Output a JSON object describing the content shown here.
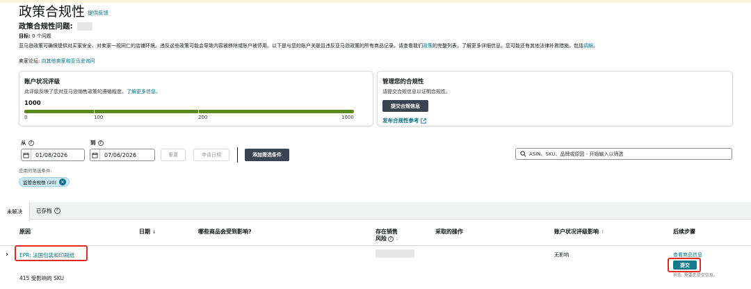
{
  "header": {
    "title": "政策合规性",
    "feedback": "提供反馈",
    "issue_label": "政策合规性问题:",
    "goal_label": "目标:",
    "goal_value": "0 个问题",
    "policy_text_prefix": "亚马逊政策可确保提供对买家安全、对卖家一视同仁的店铺环境。违反这些政策可能会导致内容被移除或账户被停用。以下是与您的账户关联且违反亚马逊政策的所有商品记录。请查看我们",
    "policy_link": "政策",
    "policy_text_mid": "的完整列表，了解更多详细信息。您可能还有其他法律补救措施，包括",
    "remedy_link": "调解",
    "policy_text_end": "。",
    "forum_label": "卖家论坛:",
    "forum_link": "向其他卖家和亚马逊询问"
  },
  "rating_card": {
    "title": "账户状况评级",
    "desc": "此评级反映了您对亚马逊销售政策的遵循程度。",
    "desc_link": "了解更多信息。",
    "score": "1000",
    "progress": 1.0,
    "ticks": [
      "0",
      "100",
      "200",
      "1000"
    ]
  },
  "manage_card": {
    "title": "管理您的合规性",
    "desc": "请提交合规信息以证明合规性。",
    "submit_button": "提交合规信息",
    "reference_link": "发布合规性参考"
  },
  "filters": {
    "from_label": "从",
    "to_label": "到",
    "from_date": "01/08/2026",
    "to_date": "07/06/2026",
    "reset": "重置",
    "apply_date": "申请日期",
    "add_filter": "添加筛选条件",
    "search_placeholder": "ASIN、SKU、品牌或原因 - 开始输入以筛选",
    "applied_label": "应用的筛选条件:",
    "chip_label": "监管合规性 (20)"
  },
  "tabs": {
    "unresolved": "未解决",
    "archived": "已存档"
  },
  "table": {
    "headers": {
      "reason": "原因",
      "date": "日期",
      "affected": "哪些商品会受到影响?",
      "risk_line1": "存在销售",
      "risk_line2": "风险",
      "action": "采取的操作",
      "rating_impact": "账户状况评级影响",
      "next_steps": "后续步骤"
    },
    "rows": [
      {
        "reason": "EPR: 法国包装和印刷纸",
        "sku_count": "415 受影响的 SKU",
        "impact": "无影响",
        "view_link": "查看商品信息",
        "submit": "提交",
        "status": "状态: 需要您提交信息。"
      }
    ]
  }
}
